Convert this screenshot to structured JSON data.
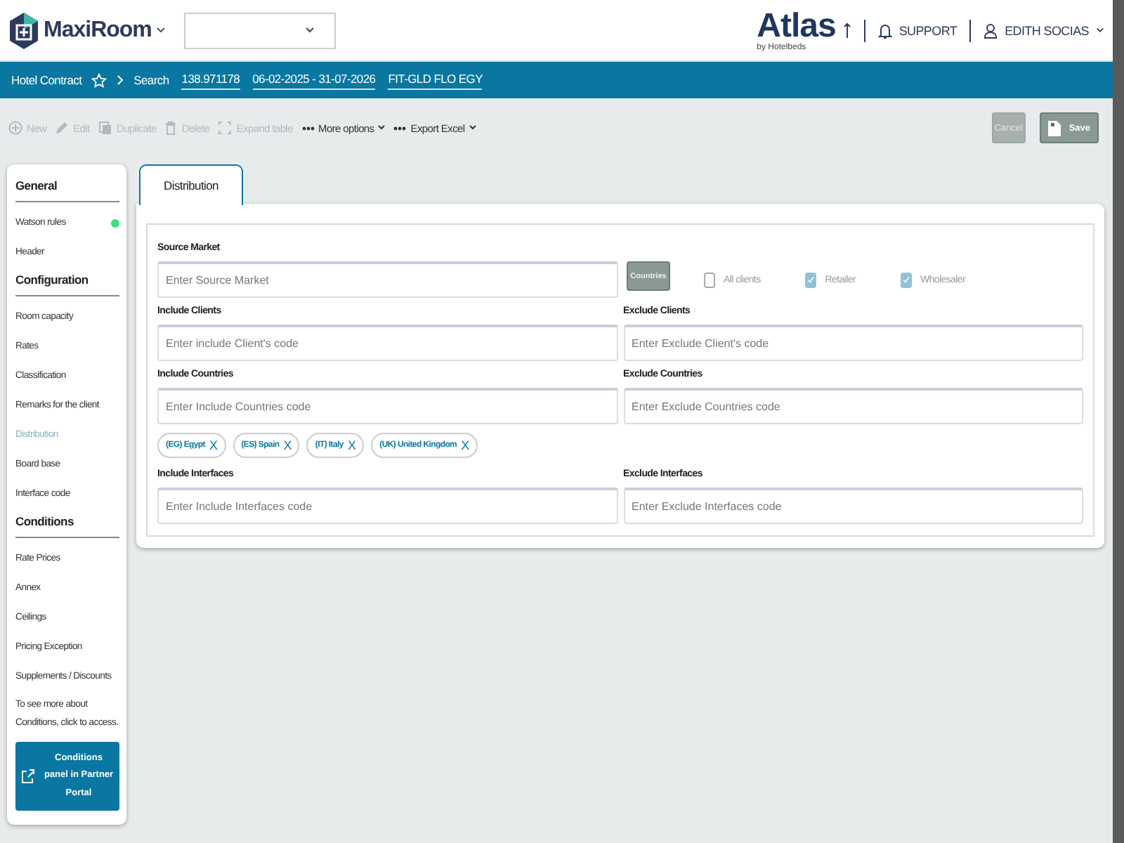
{
  "header": {
    "app_name": "MaxiRoom",
    "brand": "Atlas",
    "brand_byline": "by Hotelbeds",
    "support": "SUPPORT",
    "user": "EDITH SOCIAS"
  },
  "breadcrumb": {
    "title": "Hotel Contract",
    "search": "Search",
    "links": [
      "138.971178",
      "06-02-2025 - 31-07-2026",
      "FIT-GLD FLO EGY"
    ]
  },
  "toolbar": {
    "actions": [
      {
        "kind": "new",
        "label": "New",
        "disabled": true
      },
      {
        "kind": "edit",
        "label": "Edit",
        "disabled": true
      },
      {
        "kind": "duplicate",
        "label": "Duplicate",
        "disabled": true
      },
      {
        "kind": "delete",
        "label": "Delete",
        "disabled": true
      },
      {
        "kind": "expand",
        "label": "Expand table",
        "disabled": true
      },
      {
        "kind": "menu",
        "label": "More options",
        "disabled": false
      },
      {
        "kind": "menu",
        "label": "Export Excel",
        "disabled": false
      }
    ],
    "cancel": {
      "label": "Cancel",
      "disabled": true
    },
    "save": {
      "label": "Save",
      "disabled": false
    }
  },
  "sidebar": {
    "sections": [
      {
        "title": "General",
        "items": [
          {
            "label": "Watson rules",
            "selected": false,
            "color": "#3ddc84"
          },
          {
            "label": "Header",
            "selected": false
          }
        ]
      },
      {
        "title": "Configuration",
        "items": [
          {
            "label": "Room capacity",
            "selected": false
          },
          {
            "label": "Rates",
            "selected": false
          },
          {
            "label": "Classification",
            "selected": false
          },
          {
            "label": "Remarks for the client",
            "selected": false
          },
          {
            "label": "Distribution",
            "selected": true
          },
          {
            "label": "Board base",
            "selected": false
          },
          {
            "label": "Interface code",
            "selected": false
          }
        ]
      },
      {
        "title": "Conditions",
        "items": [
          {
            "label": "Rate Prices",
            "selected": false
          },
          {
            "label": "Annex",
            "selected": false
          },
          {
            "label": "Ceilings",
            "selected": false
          },
          {
            "label": "Pricing Exception",
            "selected": false
          },
          {
            "label": "Supplements / Discounts",
            "selected": false
          }
        ]
      }
    ],
    "note": "To see more about Conditions, click to access.",
    "portal_button": "Conditions panel in Partner Portal"
  },
  "tabs": [
    {
      "label": "Distribution",
      "selected": true
    }
  ],
  "form": {
    "source_market": {
      "label": "Source Market",
      "placeholder": "Enter Source Market"
    },
    "countries_button": "Countries",
    "client_types": [
      {
        "label": "All clients",
        "checked": false
      },
      {
        "label": "Retailer",
        "checked": true
      },
      {
        "label": "Wholesaler",
        "checked": true
      }
    ],
    "rows": [
      {
        "left": {
          "label": "Include Clients",
          "placeholder": "Enter include Client's code"
        },
        "right": {
          "label": "Exclude Clients",
          "placeholder": "Enter Exclude Client's code"
        }
      },
      {
        "left": {
          "label": "Include Countries",
          "placeholder": "Enter Include Countries code"
        },
        "right": {
          "label": "Exclude Countries",
          "placeholder": "Enter Exclude Countries code"
        },
        "tags": [
          {
            "label": "(EG) Egypt",
            "remove": "X"
          },
          {
            "label": "(ES) Spain",
            "remove": "X"
          },
          {
            "label": "(IT) Italy",
            "remove": "X"
          },
          {
            "label": "(UK) United Kingdom",
            "remove": "X"
          }
        ]
      },
      {
        "left": {
          "label": "Include Interfaces",
          "placeholder": "Enter Include Interfaces code"
        },
        "right": {
          "label": "Exclude Interfaces",
          "placeholder": "Enter Exclude Interfaces code"
        }
      }
    ]
  }
}
